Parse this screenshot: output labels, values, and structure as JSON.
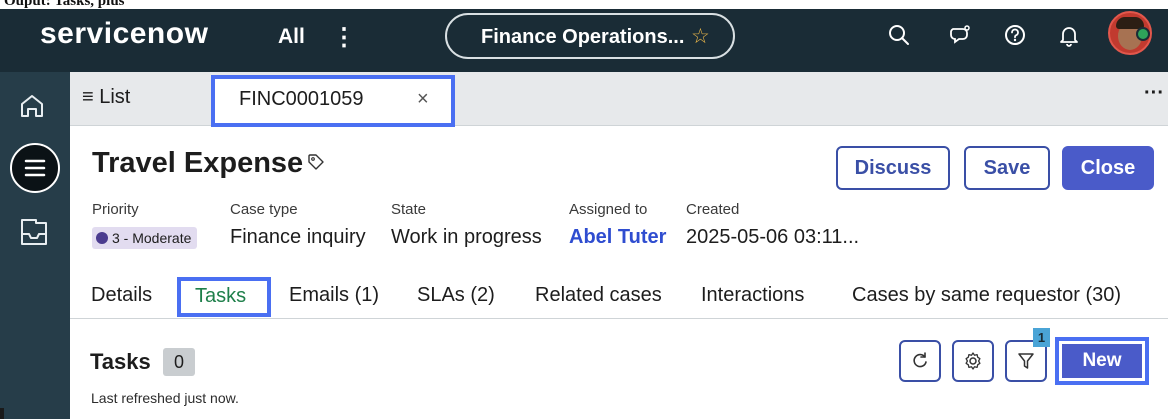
{
  "caption": "Ouput: Tasks, plus",
  "topnav": {
    "logo": "servicenow",
    "all_label": "All",
    "more_label": "⋮",
    "workspace_title": "Finance Operations...",
    "star_icon": "star-icon",
    "icons": [
      "search-icon",
      "sparkle-chat-icon",
      "help-icon",
      "bell-icon"
    ],
    "avatar_status_color": "#2ea35a"
  },
  "rail": {
    "icons": [
      "home-icon",
      "list-icon",
      "inbox-icon"
    ]
  },
  "tabstrip": {
    "list_label": "≡ List",
    "record_tab_label": "FINC0001059",
    "record_tab_close": "×",
    "more_label": "···"
  },
  "record": {
    "title": "Travel Expense",
    "buttons": {
      "discuss": "Discuss",
      "save": "Save",
      "close": "Close"
    },
    "fields": {
      "priority_label": "Priority",
      "priority_value": "3 - Moderate",
      "case_type_label": "Case type",
      "case_type_value": "Finance inquiry",
      "state_label": "State",
      "state_value": "Work in progress",
      "assigned_label": "Assigned to",
      "assigned_value": "Abel Tuter",
      "created_label": "Created",
      "created_value": "2025-05-06 03:11..."
    }
  },
  "record_tabs": [
    "Details",
    "Tasks",
    "Emails (1)",
    "SLAs (2)",
    "Related cases",
    "Interactions",
    "Cases by same requestor (30)"
  ],
  "tasks": {
    "title": "Tasks",
    "count": "0",
    "refreshed": "Last refreshed just now.",
    "filter_badge": "1",
    "new_label": "New"
  },
  "colors": {
    "nav_bg": "#1a2c36",
    "rail_bg": "#263d49",
    "accent": "#4a5bc9",
    "highlight": "#4a6ff2",
    "active_tab_text": "#1e7f4a",
    "priority_badge": "#e2dcf0"
  }
}
